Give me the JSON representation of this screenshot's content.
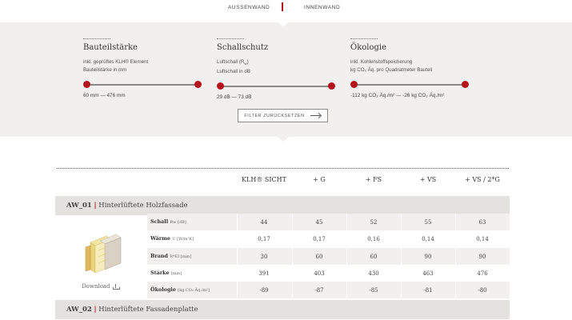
{
  "nav": {
    "tabs": [
      "AUSSENWAND",
      "INNENWAND"
    ]
  },
  "filters": [
    {
      "title": "Bauteilstärke",
      "desc_line1": "inkl. geprüftes KLH® Element",
      "desc_line2": "Bauteilstärke in mm",
      "range": "60 mm — 476 mm"
    },
    {
      "title": "Schallschutz",
      "desc_line1_main": "Luftschall (R",
      "desc_line1_sub": "w",
      "desc_line1_end": ")",
      "desc_line2": "Luftschall in dB",
      "range": "29 dB — 73 dB"
    },
    {
      "title": "Ökologie",
      "desc_line1": "inkl. Kohlenstoffspeicherung",
      "desc_line2": "kg CO₂ Äq. pro Quadratmeter Bauteil",
      "range": "-112 kg CO₂ Äq./m² — -26 kg CO₂ Äq./m²"
    }
  ],
  "reset_label": "FILTER ZURÜCKSETZEN",
  "columns": [
    "KLH® SICHT",
    "+ G",
    "+ FS",
    "+ VS",
    "+ VS / 2*G"
  ],
  "groups": [
    {
      "code": "AW_01",
      "separator": "|",
      "name": "Hinterlüftete Holzfassade",
      "download": "Download",
      "rows": [
        {
          "label": "Schall",
          "unit": "Rw [dB]",
          "values": [
            "44",
            "45",
            "52",
            "55",
            "63"
          ]
        },
        {
          "label": "Wärme",
          "unit": "U [W/m²K]",
          "values": [
            "0,17",
            "0,17",
            "0,16",
            "0,14",
            "0,14"
          ]
        },
        {
          "label": "Brand",
          "unit": "R*EI [min]",
          "values": [
            "30",
            "60",
            "60",
            "90",
            "90"
          ]
        },
        {
          "label": "Stärke",
          "unit": "[mm]",
          "values": [
            "391",
            "403",
            "430",
            "463",
            "476"
          ]
        },
        {
          "label": "Ökologie",
          "unit": "[kg CO₂ Äq./m²]",
          "values": [
            "-89",
            "-87",
            "-85",
            "-81",
            "-80"
          ]
        }
      ]
    },
    {
      "code": "AW_02",
      "separator": "|",
      "name": "Hinterlüftete Fassadenplatte"
    }
  ],
  "colors": {
    "accent": "#b5121b",
    "panel": "#f1f0ee",
    "group": "#e4e2df"
  },
  "icons": [
    "arrow-right-icon",
    "download-icon",
    "wall-product-image"
  ]
}
